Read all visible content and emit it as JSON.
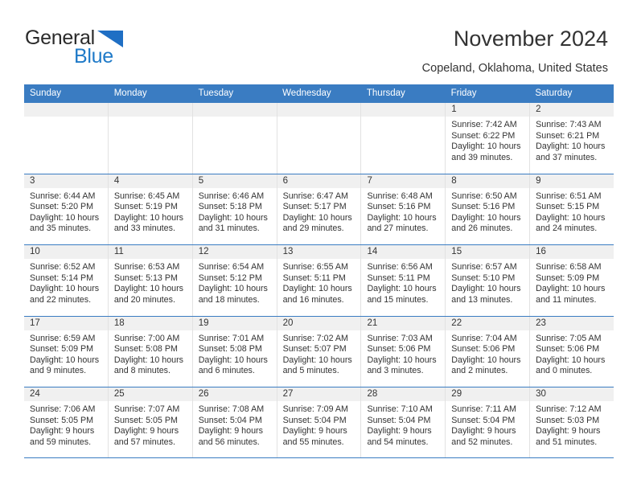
{
  "brand": {
    "name_top": "General",
    "name_bottom": "Blue",
    "accent_color": "#1f7ac8",
    "header_color": "#3a7cc2"
  },
  "header": {
    "title": "November 2024",
    "subtitle": "Copeland, Oklahoma, United States"
  },
  "calendar": {
    "weekdays": [
      "Sunday",
      "Monday",
      "Tuesday",
      "Wednesday",
      "Thursday",
      "Friday",
      "Saturday"
    ],
    "weeks": [
      [
        {
          "day": "",
          "sunrise": "",
          "sunset": "",
          "daylight1": "",
          "daylight2": "",
          "empty": true
        },
        {
          "day": "",
          "sunrise": "",
          "sunset": "",
          "daylight1": "",
          "daylight2": "",
          "empty": true
        },
        {
          "day": "",
          "sunrise": "",
          "sunset": "",
          "daylight1": "",
          "daylight2": "",
          "empty": true
        },
        {
          "day": "",
          "sunrise": "",
          "sunset": "",
          "daylight1": "",
          "daylight2": "",
          "empty": true
        },
        {
          "day": "",
          "sunrise": "",
          "sunset": "",
          "daylight1": "",
          "daylight2": "",
          "empty": true
        },
        {
          "day": "1",
          "sunrise": "Sunrise: 7:42 AM",
          "sunset": "Sunset: 6:22 PM",
          "daylight1": "Daylight: 10 hours",
          "daylight2": "and 39 minutes."
        },
        {
          "day": "2",
          "sunrise": "Sunrise: 7:43 AM",
          "sunset": "Sunset: 6:21 PM",
          "daylight1": "Daylight: 10 hours",
          "daylight2": "and 37 minutes."
        }
      ],
      [
        {
          "day": "3",
          "sunrise": "Sunrise: 6:44 AM",
          "sunset": "Sunset: 5:20 PM",
          "daylight1": "Daylight: 10 hours",
          "daylight2": "and 35 minutes."
        },
        {
          "day": "4",
          "sunrise": "Sunrise: 6:45 AM",
          "sunset": "Sunset: 5:19 PM",
          "daylight1": "Daylight: 10 hours",
          "daylight2": "and 33 minutes."
        },
        {
          "day": "5",
          "sunrise": "Sunrise: 6:46 AM",
          "sunset": "Sunset: 5:18 PM",
          "daylight1": "Daylight: 10 hours",
          "daylight2": "and 31 minutes."
        },
        {
          "day": "6",
          "sunrise": "Sunrise: 6:47 AM",
          "sunset": "Sunset: 5:17 PM",
          "daylight1": "Daylight: 10 hours",
          "daylight2": "and 29 minutes."
        },
        {
          "day": "7",
          "sunrise": "Sunrise: 6:48 AM",
          "sunset": "Sunset: 5:16 PM",
          "daylight1": "Daylight: 10 hours",
          "daylight2": "and 27 minutes."
        },
        {
          "day": "8",
          "sunrise": "Sunrise: 6:50 AM",
          "sunset": "Sunset: 5:16 PM",
          "daylight1": "Daylight: 10 hours",
          "daylight2": "and 26 minutes."
        },
        {
          "day": "9",
          "sunrise": "Sunrise: 6:51 AM",
          "sunset": "Sunset: 5:15 PM",
          "daylight1": "Daylight: 10 hours",
          "daylight2": "and 24 minutes."
        }
      ],
      [
        {
          "day": "10",
          "sunrise": "Sunrise: 6:52 AM",
          "sunset": "Sunset: 5:14 PM",
          "daylight1": "Daylight: 10 hours",
          "daylight2": "and 22 minutes."
        },
        {
          "day": "11",
          "sunrise": "Sunrise: 6:53 AM",
          "sunset": "Sunset: 5:13 PM",
          "daylight1": "Daylight: 10 hours",
          "daylight2": "and 20 minutes."
        },
        {
          "day": "12",
          "sunrise": "Sunrise: 6:54 AM",
          "sunset": "Sunset: 5:12 PM",
          "daylight1": "Daylight: 10 hours",
          "daylight2": "and 18 minutes."
        },
        {
          "day": "13",
          "sunrise": "Sunrise: 6:55 AM",
          "sunset": "Sunset: 5:11 PM",
          "daylight1": "Daylight: 10 hours",
          "daylight2": "and 16 minutes."
        },
        {
          "day": "14",
          "sunrise": "Sunrise: 6:56 AM",
          "sunset": "Sunset: 5:11 PM",
          "daylight1": "Daylight: 10 hours",
          "daylight2": "and 15 minutes."
        },
        {
          "day": "15",
          "sunrise": "Sunrise: 6:57 AM",
          "sunset": "Sunset: 5:10 PM",
          "daylight1": "Daylight: 10 hours",
          "daylight2": "and 13 minutes."
        },
        {
          "day": "16",
          "sunrise": "Sunrise: 6:58 AM",
          "sunset": "Sunset: 5:09 PM",
          "daylight1": "Daylight: 10 hours",
          "daylight2": "and 11 minutes."
        }
      ],
      [
        {
          "day": "17",
          "sunrise": "Sunrise: 6:59 AM",
          "sunset": "Sunset: 5:09 PM",
          "daylight1": "Daylight: 10 hours",
          "daylight2": "and 9 minutes."
        },
        {
          "day": "18",
          "sunrise": "Sunrise: 7:00 AM",
          "sunset": "Sunset: 5:08 PM",
          "daylight1": "Daylight: 10 hours",
          "daylight2": "and 8 minutes."
        },
        {
          "day": "19",
          "sunrise": "Sunrise: 7:01 AM",
          "sunset": "Sunset: 5:08 PM",
          "daylight1": "Daylight: 10 hours",
          "daylight2": "and 6 minutes."
        },
        {
          "day": "20",
          "sunrise": "Sunrise: 7:02 AM",
          "sunset": "Sunset: 5:07 PM",
          "daylight1": "Daylight: 10 hours",
          "daylight2": "and 5 minutes."
        },
        {
          "day": "21",
          "sunrise": "Sunrise: 7:03 AM",
          "sunset": "Sunset: 5:06 PM",
          "daylight1": "Daylight: 10 hours",
          "daylight2": "and 3 minutes."
        },
        {
          "day": "22",
          "sunrise": "Sunrise: 7:04 AM",
          "sunset": "Sunset: 5:06 PM",
          "daylight1": "Daylight: 10 hours",
          "daylight2": "and 2 minutes."
        },
        {
          "day": "23",
          "sunrise": "Sunrise: 7:05 AM",
          "sunset": "Sunset: 5:06 PM",
          "daylight1": "Daylight: 10 hours",
          "daylight2": "and 0 minutes."
        }
      ],
      [
        {
          "day": "24",
          "sunrise": "Sunrise: 7:06 AM",
          "sunset": "Sunset: 5:05 PM",
          "daylight1": "Daylight: 9 hours",
          "daylight2": "and 59 minutes."
        },
        {
          "day": "25",
          "sunrise": "Sunrise: 7:07 AM",
          "sunset": "Sunset: 5:05 PM",
          "daylight1": "Daylight: 9 hours",
          "daylight2": "and 57 minutes."
        },
        {
          "day": "26",
          "sunrise": "Sunrise: 7:08 AM",
          "sunset": "Sunset: 5:04 PM",
          "daylight1": "Daylight: 9 hours",
          "daylight2": "and 56 minutes."
        },
        {
          "day": "27",
          "sunrise": "Sunrise: 7:09 AM",
          "sunset": "Sunset: 5:04 PM",
          "daylight1": "Daylight: 9 hours",
          "daylight2": "and 55 minutes."
        },
        {
          "day": "28",
          "sunrise": "Sunrise: 7:10 AM",
          "sunset": "Sunset: 5:04 PM",
          "daylight1": "Daylight: 9 hours",
          "daylight2": "and 54 minutes."
        },
        {
          "day": "29",
          "sunrise": "Sunrise: 7:11 AM",
          "sunset": "Sunset: 5:04 PM",
          "daylight1": "Daylight: 9 hours",
          "daylight2": "and 52 minutes."
        },
        {
          "day": "30",
          "sunrise": "Sunrise: 7:12 AM",
          "sunset": "Sunset: 5:03 PM",
          "daylight1": "Daylight: 9 hours",
          "daylight2": "and 51 minutes."
        }
      ]
    ]
  }
}
